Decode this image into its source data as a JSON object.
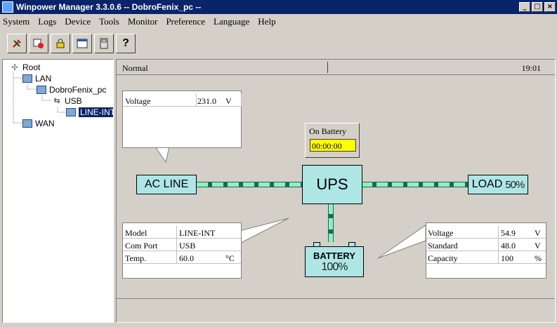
{
  "window": {
    "title": "Winpower Manager 3.3.0.6 -- DobroFenix_pc --",
    "min": "_",
    "max": "□",
    "close": "×"
  },
  "menu": [
    "System",
    "Logs",
    "Device",
    "Tools",
    "Monitor",
    "Preference",
    "Language",
    "Help"
  ],
  "toolbar": {
    "buttons": [
      "wrench-icon",
      "schedule-icon",
      "lock-icon",
      "config-icon",
      "calculator-icon",
      "help-icon"
    ],
    "help_glyph": "?"
  },
  "tree": {
    "root": "Root",
    "lan": "LAN",
    "pc": "DobroFenix_pc",
    "usb": "USB",
    "device": "LINE-INT",
    "wan": "WAN"
  },
  "status": {
    "state": "Normal",
    "time": "19:01"
  },
  "voltage_panel": {
    "label": "Voltage",
    "value": "231.0",
    "unit": "V"
  },
  "on_battery": {
    "label": "On Battery",
    "timer": "00:00:00"
  },
  "diagram": {
    "ac_line": "AC LINE",
    "ups": "UPS",
    "load": "LOAD",
    "load_pct": "50%",
    "battery": "BATTERY",
    "battery_pct": "100%"
  },
  "info_panel": {
    "rows": [
      {
        "label": "Model",
        "value": "LINE-INT",
        "unit": ""
      },
      {
        "label": "Com Port",
        "value": "USB",
        "unit": ""
      },
      {
        "label": "Temp.",
        "value": "60.0",
        "unit": "°C"
      }
    ]
  },
  "battery_panel": {
    "rows": [
      {
        "label": "Voltage",
        "value": "54.9",
        "unit": "V"
      },
      {
        "label": "Standard",
        "value": "48.0",
        "unit": "V"
      },
      {
        "label": "Capacity",
        "value": "100",
        "unit": "%"
      }
    ]
  },
  "colors": {
    "titlebar": "#0a246a",
    "box_fill": "#aee6e6",
    "timer_bg": "#ffff00",
    "line": "#8ef0c0"
  }
}
